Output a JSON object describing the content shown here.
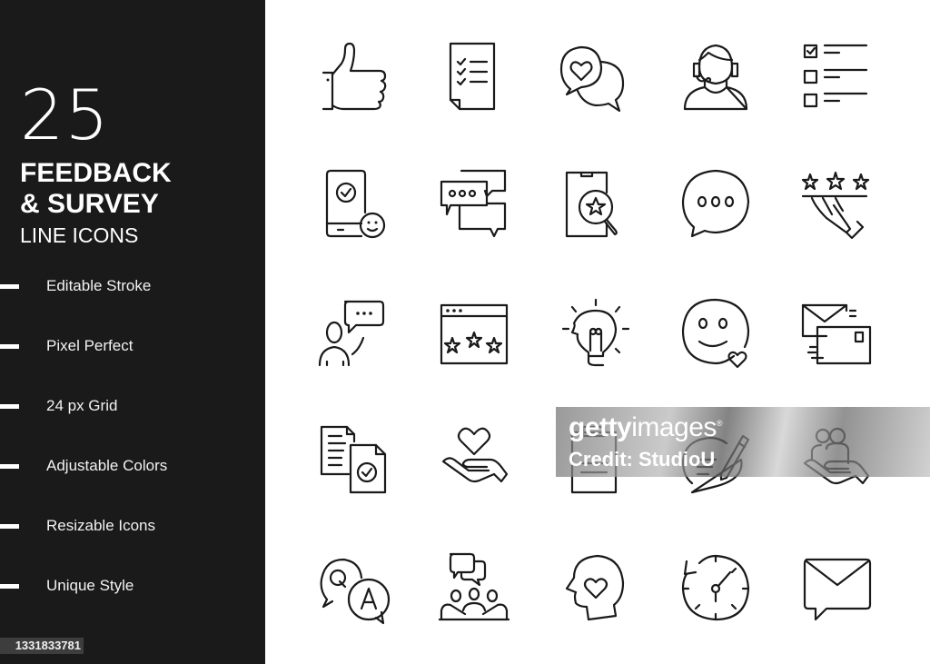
{
  "sidebar": {
    "count": "25",
    "title_line1": "FEEDBACK",
    "title_line2": "& SURVEY",
    "subtitle": "LINE ICONS",
    "features": [
      {
        "label": "Editable Stroke"
      },
      {
        "label": "Pixel Perfect"
      },
      {
        "label": "24 px Grid"
      },
      {
        "label": "Adjustable Colors"
      },
      {
        "label": "Resizable Icons"
      },
      {
        "label": "Unique Style"
      }
    ],
    "image_id": "1331833781"
  },
  "icons": [
    {
      "name": "thumbs-up-icon"
    },
    {
      "name": "checklist-document-icon"
    },
    {
      "name": "heart-chat-bubbles-icon"
    },
    {
      "name": "customer-support-headset-icon"
    },
    {
      "name": "checkbox-list-icon"
    },
    {
      "name": "mobile-check-smiley-icon"
    },
    {
      "name": "multiple-chat-bubbles-icon"
    },
    {
      "name": "mobile-star-search-icon"
    },
    {
      "name": "chat-bubble-dots-icon"
    },
    {
      "name": "star-rating-hand-icon"
    },
    {
      "name": "person-speech-bubble-icon"
    },
    {
      "name": "browser-star-rating-icon"
    },
    {
      "name": "head-lightbulb-idea-icon"
    },
    {
      "name": "smiley-heart-icon"
    },
    {
      "name": "mail-envelopes-icon"
    },
    {
      "name": "approved-documents-icon"
    },
    {
      "name": "hand-heart-icon"
    },
    {
      "name": "clipboard-icon"
    },
    {
      "name": "chat-pen-icon"
    },
    {
      "name": "hand-holding-people-icon"
    },
    {
      "name": "question-answer-icon"
    },
    {
      "name": "group-discussion-icon"
    },
    {
      "name": "head-heart-icon"
    },
    {
      "name": "clock-rewind-icon"
    },
    {
      "name": "envelope-message-icon"
    }
  ],
  "watermark": {
    "brand_bold": "getty",
    "brand_light": "images",
    "brand_mark": "®",
    "credit": "Credit: StudioU"
  }
}
